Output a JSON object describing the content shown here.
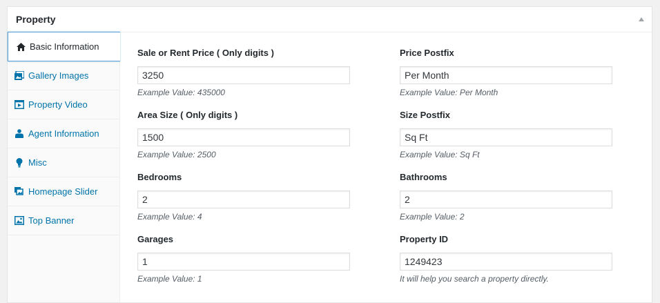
{
  "metabox": {
    "title": "Property"
  },
  "tabs": [
    {
      "label": "Basic Information",
      "icon": "home-icon",
      "active": true
    },
    {
      "label": "Gallery Images",
      "icon": "gallery-icon",
      "active": false
    },
    {
      "label": "Property Video",
      "icon": "video-icon",
      "active": false
    },
    {
      "label": "Agent Information",
      "icon": "agent-icon",
      "active": false
    },
    {
      "label": "Misc",
      "icon": "lightbulb-icon",
      "active": false
    },
    {
      "label": "Homepage Slider",
      "icon": "slider-icon",
      "active": false
    },
    {
      "label": "Top Banner",
      "icon": "banner-icon",
      "active": false
    }
  ],
  "fields": {
    "price": {
      "label": "Sale or Rent Price ( Only digits )",
      "value": "3250",
      "hint": "Example Value: 435000"
    },
    "price_postfix": {
      "label": "Price Postfix",
      "value": "Per Month",
      "hint": "Example Value: Per Month"
    },
    "area": {
      "label": "Area Size ( Only digits )",
      "value": "1500",
      "hint": "Example Value: 2500"
    },
    "size_postfix": {
      "label": "Size Postfix",
      "value": "Sq Ft",
      "hint": "Example Value: Sq Ft"
    },
    "bedrooms": {
      "label": "Bedrooms",
      "value": "2",
      "hint": "Example Value: 4"
    },
    "bathrooms": {
      "label": "Bathrooms",
      "value": "2",
      "hint": "Example Value: 2"
    },
    "garages": {
      "label": "Garages",
      "value": "1",
      "hint": "Example Value: 1"
    },
    "property_id": {
      "label": "Property ID",
      "value": "1249423",
      "hint": "It will help you search a property directly."
    }
  },
  "colors": {
    "link": "#0073aa",
    "active_border": "#5b9dd9",
    "text": "#23282d"
  }
}
